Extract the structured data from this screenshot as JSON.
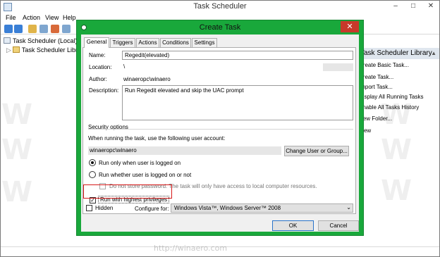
{
  "main_window": {
    "title": "Task Scheduler",
    "controls": {
      "minimize": "–",
      "maximize": "□",
      "close": "✕"
    },
    "menu": [
      "File",
      "Action",
      "View",
      "Help"
    ],
    "tree": [
      "Task Scheduler (Local)",
      "Task Scheduler Library"
    ],
    "actions": {
      "header": "Task Scheduler Library",
      "items": [
        "Create Basic Task...",
        "Create Task...",
        "Import Task...",
        "Display All Running Tasks",
        "Enable All Tasks History",
        "New Folder...",
        "View"
      ]
    },
    "watermark": "http://winaero.com"
  },
  "dialog": {
    "title": "Create Task",
    "close": "✕",
    "tabs": [
      "General",
      "Triggers",
      "Actions",
      "Conditions",
      "Settings"
    ],
    "active_tab": "General",
    "name_label": "Name:",
    "name_value": "Regedit(elevated)",
    "location_label": "Location:",
    "location_value": "\\",
    "author_label": "Author:",
    "author_value": "winaeropc\\winaero",
    "description_label": "Description:",
    "description_value": "Run Regedit elevated and skip the UAC prompt",
    "security": {
      "title": "Security options",
      "account_prompt": "When running the task, use the following user account:",
      "account_value": "winaeropc\\winaero",
      "change_button": "Change User or Group...",
      "radio_logged_on": "Run only when user is logged on",
      "radio_whether": "Run whether user is logged on or not",
      "no_store_password": "Do not store password.  The task will only have access to local computer resources.",
      "highest_privileges": "Run with highest privileges"
    },
    "hidden_label": "Hidden",
    "configure_label": "Configure for:",
    "configure_value": "Windows Vista™, Windows Server™ 2008",
    "ok_button": "OK",
    "cancel_button": "Cancel",
    "states": {
      "run_only_logged_on": true,
      "run_with_highest": true,
      "hidden": false,
      "no_store_password": false
    },
    "accent_color": "#19a83b",
    "highlight_color": "#d61a1a"
  }
}
